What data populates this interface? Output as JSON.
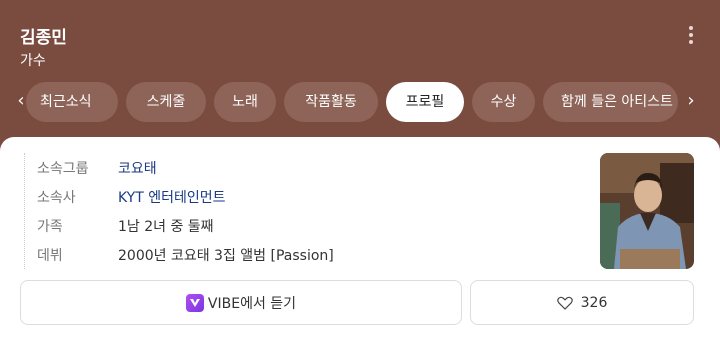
{
  "header": {
    "title": "김종민",
    "subtitle": "가수"
  },
  "tabs": [
    {
      "label": "최근소식"
    },
    {
      "label": "스케줄"
    },
    {
      "label": "노래"
    },
    {
      "label": "작품활동"
    },
    {
      "label": "프로필"
    },
    {
      "label": "수상"
    },
    {
      "label": "함께 들은 아티스트"
    }
  ],
  "active_tab": "프로필",
  "profile": {
    "rows": [
      {
        "label": "소속그룹",
        "value": "코요태"
      },
      {
        "label": "소속사",
        "value": "KYT 엔터테인먼트"
      },
      {
        "label": "가족",
        "value": "1남 2녀 중 둘째"
      },
      {
        "label": "데뷔",
        "value": "2000년 코요태 3집 앨범 [Passion]"
      }
    ]
  },
  "actions": {
    "vibe_label": "VIBE에서 듣기",
    "like_count": "326"
  },
  "colors": {
    "header_bg": "#7a4b3f",
    "tab_bg": "#8e6458",
    "link": "#1a3a82"
  }
}
